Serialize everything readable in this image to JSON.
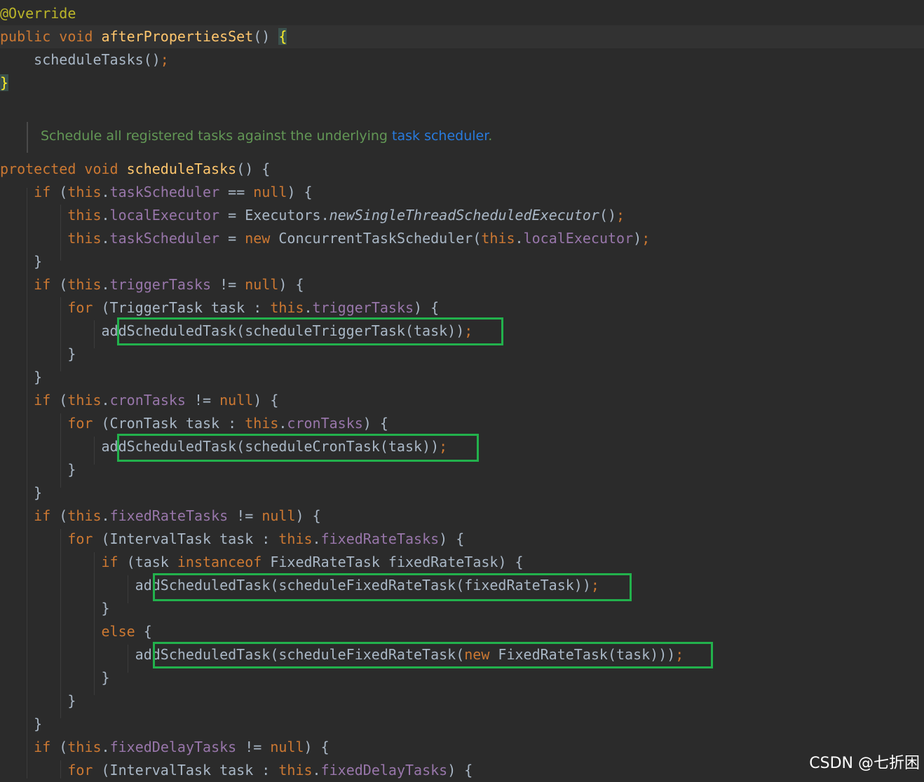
{
  "editor": {
    "language": "java",
    "theme": "darcula",
    "colors": {
      "background": "#2b2b2b",
      "current_line": "#323232",
      "text": "#a9b7c6",
      "keyword": "#cc7832",
      "method": "#ffc66d",
      "field": "#9876aa",
      "annotation": "#bbb529",
      "doc_comment": "#629755",
      "doc_link": "#287bde",
      "highlight_box": "#22b14c"
    },
    "doc_comment": {
      "text": "Schedule all registered tasks against the underlying ",
      "link": "task scheduler",
      "end": "."
    },
    "lines": [
      [
        {
          "t": "@Override",
          "c": "ann"
        }
      ],
      [
        {
          "t": "public",
          "c": "kw"
        },
        {
          "t": " "
        },
        {
          "t": "void",
          "c": "kw"
        },
        {
          "t": " "
        },
        {
          "t": "afterPropertiesSet",
          "c": "fn"
        },
        {
          "t": "() "
        },
        {
          "t": "{",
          "c": "bm"
        }
      ],
      [
        {
          "t": "    scheduleTasks()"
        },
        {
          "t": ";",
          "c": "kw"
        }
      ],
      [
        {
          "t": "}",
          "c": "bm"
        }
      ],
      [
        {
          "t": "protected",
          "c": "kw"
        },
        {
          "t": " "
        },
        {
          "t": "void",
          "c": "kw"
        },
        {
          "t": " "
        },
        {
          "t": "scheduleTasks",
          "c": "fn"
        },
        {
          "t": "() {"
        }
      ],
      [
        {
          "t": "    "
        },
        {
          "t": "if",
          "c": "kw"
        },
        {
          "t": " ("
        },
        {
          "t": "this",
          "c": "kw"
        },
        {
          "t": "."
        },
        {
          "t": "taskScheduler",
          "c": "fld"
        },
        {
          "t": " == "
        },
        {
          "t": "null",
          "c": "kw"
        },
        {
          "t": ") {"
        }
      ],
      [
        {
          "t": "        "
        },
        {
          "t": "this",
          "c": "kw"
        },
        {
          "t": "."
        },
        {
          "t": "localExecutor",
          "c": "fld"
        },
        {
          "t": " = Executors."
        },
        {
          "t": "newSingleThreadScheduledExecutor",
          "c": "it"
        },
        {
          "t": "()"
        },
        {
          "t": ";",
          "c": "kw"
        }
      ],
      [
        {
          "t": "        "
        },
        {
          "t": "this",
          "c": "kw"
        },
        {
          "t": "."
        },
        {
          "t": "taskScheduler",
          "c": "fld"
        },
        {
          "t": " = "
        },
        {
          "t": "new",
          "c": "kw"
        },
        {
          "t": " ConcurrentTaskScheduler("
        },
        {
          "t": "this",
          "c": "kw"
        },
        {
          "t": "."
        },
        {
          "t": "localExecutor",
          "c": "fld"
        },
        {
          "t": ")"
        },
        {
          "t": ";",
          "c": "kw"
        }
      ],
      [
        {
          "t": "    }"
        }
      ],
      [
        {
          "t": "    "
        },
        {
          "t": "if",
          "c": "kw"
        },
        {
          "t": " ("
        },
        {
          "t": "this",
          "c": "kw"
        },
        {
          "t": "."
        },
        {
          "t": "triggerTasks",
          "c": "fld"
        },
        {
          "t": " != "
        },
        {
          "t": "null",
          "c": "kw"
        },
        {
          "t": ") {"
        }
      ],
      [
        {
          "t": "        "
        },
        {
          "t": "for",
          "c": "kw"
        },
        {
          "t": " (TriggerTask task : "
        },
        {
          "t": "this",
          "c": "kw"
        },
        {
          "t": "."
        },
        {
          "t": "triggerTasks",
          "c": "fld"
        },
        {
          "t": ") {"
        }
      ],
      [
        {
          "t": "            addScheduledTask(scheduleTriggerTask(task))"
        },
        {
          "t": ";",
          "c": "kw"
        }
      ],
      [
        {
          "t": "        }"
        }
      ],
      [
        {
          "t": "    }"
        }
      ],
      [
        {
          "t": "    "
        },
        {
          "t": "if",
          "c": "kw"
        },
        {
          "t": " ("
        },
        {
          "t": "this",
          "c": "kw"
        },
        {
          "t": "."
        },
        {
          "t": "cronTasks",
          "c": "fld"
        },
        {
          "t": " != "
        },
        {
          "t": "null",
          "c": "kw"
        },
        {
          "t": ") {"
        }
      ],
      [
        {
          "t": "        "
        },
        {
          "t": "for",
          "c": "kw"
        },
        {
          "t": " (CronTask task : "
        },
        {
          "t": "this",
          "c": "kw"
        },
        {
          "t": "."
        },
        {
          "t": "cronTasks",
          "c": "fld"
        },
        {
          "t": ") {"
        }
      ],
      [
        {
          "t": "            addScheduledTask(scheduleCronTask(task))"
        },
        {
          "t": ";",
          "c": "kw"
        }
      ],
      [
        {
          "t": "        }"
        }
      ],
      [
        {
          "t": "    }"
        }
      ],
      [
        {
          "t": "    "
        },
        {
          "t": "if",
          "c": "kw"
        },
        {
          "t": " ("
        },
        {
          "t": "this",
          "c": "kw"
        },
        {
          "t": "."
        },
        {
          "t": "fixedRateTasks",
          "c": "fld"
        },
        {
          "t": " != "
        },
        {
          "t": "null",
          "c": "kw"
        },
        {
          "t": ") {"
        }
      ],
      [
        {
          "t": "        "
        },
        {
          "t": "for",
          "c": "kw"
        },
        {
          "t": " (IntervalTask task : "
        },
        {
          "t": "this",
          "c": "kw"
        },
        {
          "t": "."
        },
        {
          "t": "fixedRateTasks",
          "c": "fld"
        },
        {
          "t": ") {"
        }
      ],
      [
        {
          "t": "            "
        },
        {
          "t": "if",
          "c": "kw"
        },
        {
          "t": " (task "
        },
        {
          "t": "instanceof",
          "c": "kw"
        },
        {
          "t": " FixedRateTask fixedRateTask) {"
        }
      ],
      [
        {
          "t": "                addScheduledTask(scheduleFixedRateTask(fixedRateTask))"
        },
        {
          "t": ";",
          "c": "kw"
        }
      ],
      [
        {
          "t": "            }"
        }
      ],
      [
        {
          "t": "            "
        },
        {
          "t": "else",
          "c": "kw"
        },
        {
          "t": " {"
        }
      ],
      [
        {
          "t": "                addScheduledTask(scheduleFixedRateTask("
        },
        {
          "t": "new",
          "c": "kw"
        },
        {
          "t": " FixedRateTask(task)))"
        },
        {
          "t": ";",
          "c": "kw"
        }
      ],
      [
        {
          "t": "            }"
        }
      ],
      [
        {
          "t": "        }"
        }
      ],
      [
        {
          "t": "    }"
        }
      ],
      [
        {
          "t": "    "
        },
        {
          "t": "if",
          "c": "kw"
        },
        {
          "t": " ("
        },
        {
          "t": "this",
          "c": "kw"
        },
        {
          "t": "."
        },
        {
          "t": "fixedDelayTasks",
          "c": "fld"
        },
        {
          "t": " != "
        },
        {
          "t": "null",
          "c": "kw"
        },
        {
          "t": ") {"
        }
      ],
      [
        {
          "t": "        "
        },
        {
          "t": "for",
          "c": "kw"
        },
        {
          "t": " (IntervalTask task : "
        },
        {
          "t": "this",
          "c": "kw"
        },
        {
          "t": "."
        },
        {
          "t": "fixedDelayTasks",
          "c": "fld"
        },
        {
          "t": ") {"
        }
      ]
    ]
  },
  "watermark": "CSDN @七折困"
}
